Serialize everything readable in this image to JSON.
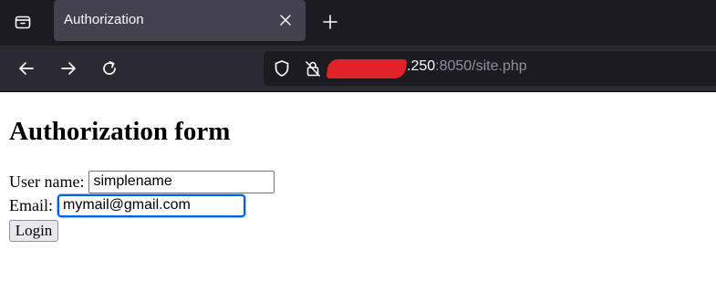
{
  "browser": {
    "tab": {
      "title": "Authorization"
    },
    "address_bar": {
      "host_suffix": ".250",
      "port_and_path": ":8050/site.php"
    },
    "icons": {
      "tab_overview": "tab-overview-icon",
      "tab_close": "close-icon",
      "new_tab": "plus-icon",
      "back": "back-arrow-icon",
      "forward": "forward-arrow-icon",
      "reload": "reload-icon",
      "tracking_protection": "shield-icon",
      "insecure_connection": "lock-crossed-icon"
    },
    "colors": {
      "tabbar_bg": "#1c1b22",
      "active_tab_bg": "#42414d",
      "navbar_bg": "#2b2a33",
      "redaction": "#e0232a"
    }
  },
  "page": {
    "title": "Authorization form",
    "form": {
      "username_label": "User name:",
      "username_value": "simplename",
      "email_label": "Email:",
      "email_value": "mymail@gmail.com",
      "submit_label": "Login"
    },
    "colors": {
      "focus_ring": "#0060df"
    }
  }
}
